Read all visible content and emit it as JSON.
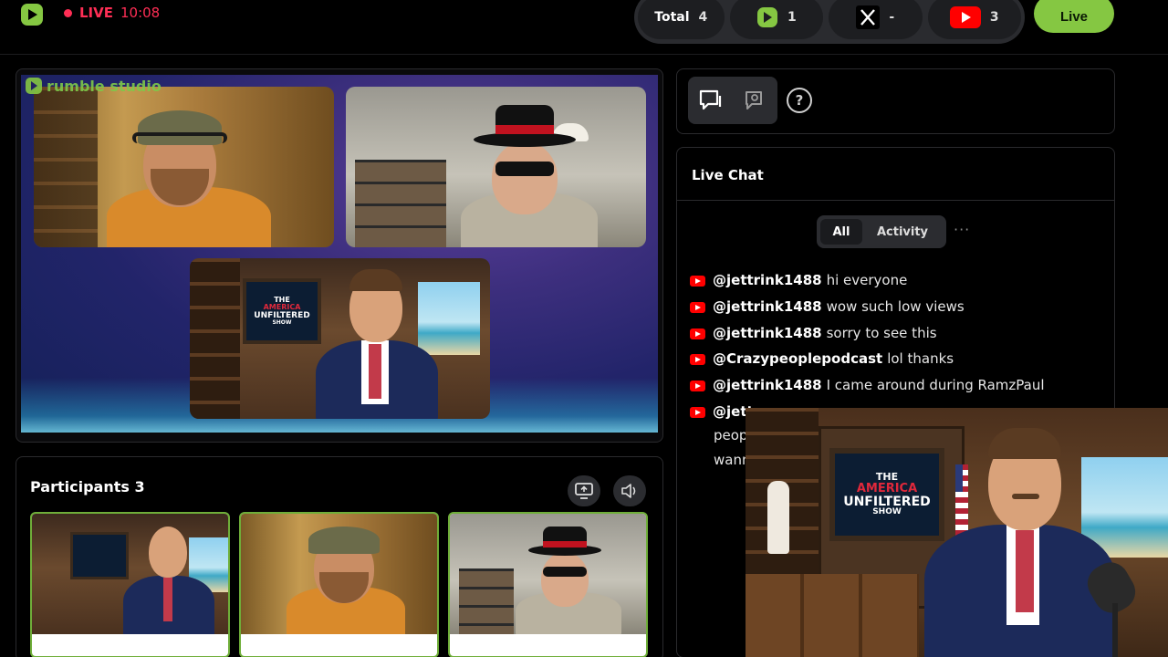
{
  "topbar": {
    "live_label": "LIVE",
    "live_time": "10:08",
    "stats": {
      "total_label": "Total",
      "total_count": "4",
      "rumble_count": "1",
      "x_count": "-",
      "youtube_count": "3"
    },
    "live_button": "Live"
  },
  "stage": {
    "brand_text": "rumble studio",
    "tv_line1": "THE",
    "tv_line2": "AMERICA",
    "tv_line3": "UNFILTERED",
    "tv_line4": "SHOW"
  },
  "chat": {
    "title": "Live Chat",
    "filters": {
      "all": "All",
      "activity": "Activity"
    },
    "more": "···",
    "messages": [
      {
        "user": "@jettrink1488",
        "text": "hi everyone"
      },
      {
        "user": "@jettrink1488",
        "text": "wow such low views"
      },
      {
        "user": "@jettrink1488",
        "text": "sorry to see this"
      },
      {
        "user": "@Crazypeoplepodcast",
        "text": "lol thanks"
      },
      {
        "user": "@jettrink1488",
        "text": "I came around during RamzPaul"
      },
      {
        "user": "@jett",
        "text": ""
      }
    ],
    "wrap_line1": "peop",
    "wrap_line2": "wann"
  },
  "participants": {
    "title": "Participants 3"
  },
  "colors": {
    "accent_green": "#85c742",
    "live_red": "#ff2e55",
    "youtube_red": "#ff0000",
    "panel_border": "#2a2a2d"
  },
  "icons": [
    "rumble-logo-icon",
    "live-dot-icon",
    "rumble-icon",
    "x-icon",
    "youtube-icon",
    "chat-icon",
    "notification-icon",
    "help-icon",
    "screen-share-icon",
    "volume-icon"
  ]
}
